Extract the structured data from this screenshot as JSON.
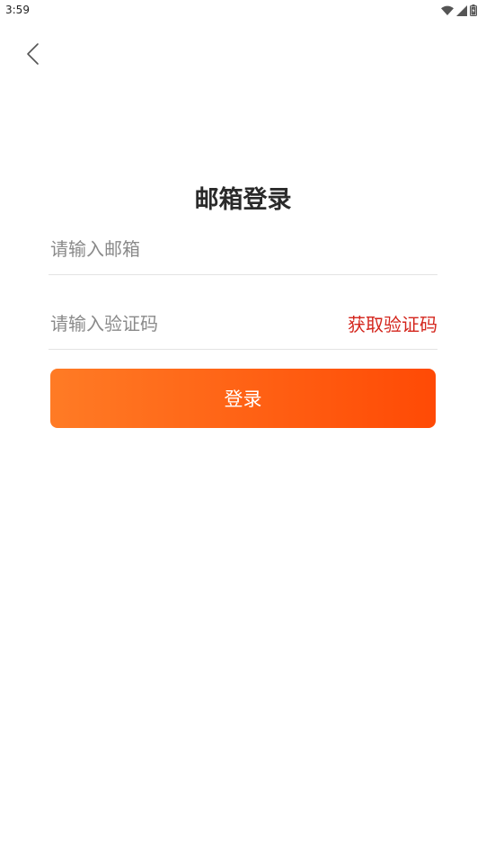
{
  "status_bar": {
    "time": "3:59",
    "icons": [
      "wifi-icon",
      "signal-icon",
      "battery-icon"
    ]
  },
  "header": {
    "back_icon": "chevron-left-icon"
  },
  "page": {
    "title": "邮箱登录"
  },
  "form": {
    "email_placeholder": "请输入邮箱",
    "code_placeholder": "请输入验证码",
    "get_code_label": "获取验证码",
    "login_label": "登录"
  },
  "colors": {
    "accent_red": "#d4261d",
    "button_gradient_start": "#ff7b25",
    "button_gradient_end": "#ff4a05"
  }
}
